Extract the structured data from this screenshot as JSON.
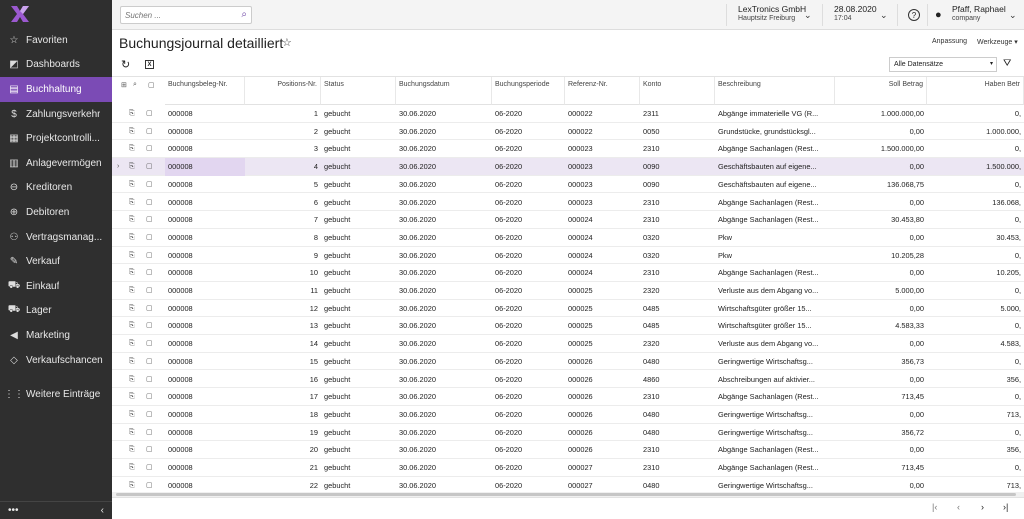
{
  "colors": {
    "accent": "#7b4bb5",
    "sidebar_bg": "#2f2f2f",
    "selected_row": "#ece6f3"
  },
  "sidebar": {
    "items": [
      {
        "label": "Favoriten",
        "icon": "star-icon",
        "glyph": "☆"
      },
      {
        "label": "Dashboards",
        "icon": "dashboard-icon",
        "glyph": "◩"
      },
      {
        "label": "Buchhaltung",
        "icon": "ledger-icon",
        "glyph": "▤",
        "active": true
      },
      {
        "label": "Zahlungsverkehr",
        "icon": "dollar-icon",
        "glyph": "$"
      },
      {
        "label": "Projektcontrolli...",
        "icon": "project-icon",
        "glyph": "▦"
      },
      {
        "label": "Anlagevermögen",
        "icon": "building-icon",
        "glyph": "▥"
      },
      {
        "label": "Kreditoren",
        "icon": "minus-circle-icon",
        "glyph": "⊖"
      },
      {
        "label": "Debitoren",
        "icon": "plus-circle-icon",
        "glyph": "⊕"
      },
      {
        "label": "Vertragsmanag...",
        "icon": "handshake-icon",
        "glyph": "⚇"
      },
      {
        "label": "Verkauf",
        "icon": "edit-icon",
        "glyph": "✎"
      },
      {
        "label": "Einkauf",
        "icon": "cart-icon",
        "glyph": "⛟"
      },
      {
        "label": "Lager",
        "icon": "truck-icon",
        "glyph": "⛟"
      },
      {
        "label": "Marketing",
        "icon": "megaphone-icon",
        "glyph": "◀"
      },
      {
        "label": "Verkaufschancen",
        "icon": "tag-icon",
        "glyph": "◇"
      }
    ],
    "more_label": "Weitere Einträge",
    "footer_dots": "•••",
    "collapse_glyph": "‹"
  },
  "topbar": {
    "search_placeholder": "Suchen ...",
    "company": "LexTronics GmbH",
    "location": "Hauptsitz Freiburg",
    "date": "28.08.2020",
    "time": "17:04",
    "help": "?",
    "user_name": "Pfaff, Raphael",
    "user_sub": "company"
  },
  "page": {
    "title": "Buchungsjournal detailliert",
    "anpassung": "Anpassung",
    "werkzeuge": "Werkzeuge",
    "dataset": "Alle Datensätze"
  },
  "table": {
    "columns": [
      "Buchungsbeleg-Nr.",
      "Positions-Nr.",
      "Status",
      "Buchungsdatum",
      "Buchungsperiode",
      "Referenz-Nr.",
      "Konto",
      "Beschreibung",
      "Soll Betrag",
      "Haben Betr"
    ],
    "rows": [
      [
        "000008",
        "1",
        "gebucht",
        "30.06.2020",
        "06-2020",
        "000022",
        "2311",
        "Abgänge immaterielle VG (R...",
        "1.000.000,00",
        "0,"
      ],
      [
        "000008",
        "2",
        "gebucht",
        "30.06.2020",
        "06-2020",
        "000022",
        "0050",
        "Grundstücke, grundstücksgl...",
        "0,00",
        "1.000.000,"
      ],
      [
        "000008",
        "3",
        "gebucht",
        "30.06.2020",
        "06-2020",
        "000023",
        "2310",
        "Abgänge Sachanlagen (Rest...",
        "1.500.000,00",
        "0,"
      ],
      [
        "000008",
        "4",
        "gebucht",
        "30.06.2020",
        "06-2020",
        "000023",
        "0090",
        "Geschäftsbauten auf eigene...",
        "0,00",
        "1.500.000,"
      ],
      [
        "000008",
        "5",
        "gebucht",
        "30.06.2020",
        "06-2020",
        "000023",
        "0090",
        "Geschäftsbauten auf eigene...",
        "136.068,75",
        "0,"
      ],
      [
        "000008",
        "6",
        "gebucht",
        "30.06.2020",
        "06-2020",
        "000023",
        "2310",
        "Abgänge Sachanlagen (Rest...",
        "0,00",
        "136.068,"
      ],
      [
        "000008",
        "7",
        "gebucht",
        "30.06.2020",
        "06-2020",
        "000024",
        "2310",
        "Abgänge Sachanlagen (Rest...",
        "30.453,80",
        "0,"
      ],
      [
        "000008",
        "8",
        "gebucht",
        "30.06.2020",
        "06-2020",
        "000024",
        "0320",
        "Pkw",
        "0,00",
        "30.453,"
      ],
      [
        "000008",
        "9",
        "gebucht",
        "30.06.2020",
        "06-2020",
        "000024",
        "0320",
        "Pkw",
        "10.205,28",
        "0,"
      ],
      [
        "000008",
        "10",
        "gebucht",
        "30.06.2020",
        "06-2020",
        "000024",
        "2310",
        "Abgänge Sachanlagen (Rest...",
        "0,00",
        "10.205,"
      ],
      [
        "000008",
        "11",
        "gebucht",
        "30.06.2020",
        "06-2020",
        "000025",
        "2320",
        "Verluste aus dem Abgang vo...",
        "5.000,00",
        "0,"
      ],
      [
        "000008",
        "12",
        "gebucht",
        "30.06.2020",
        "06-2020",
        "000025",
        "0485",
        "Wirtschaftsgüter größer 15...",
        "0,00",
        "5.000,"
      ],
      [
        "000008",
        "13",
        "gebucht",
        "30.06.2020",
        "06-2020",
        "000025",
        "0485",
        "Wirtschaftsgüter größer 15...",
        "4.583,33",
        "0,"
      ],
      [
        "000008",
        "14",
        "gebucht",
        "30.06.2020",
        "06-2020",
        "000025",
        "2320",
        "Verluste aus dem Abgang vo...",
        "0,00",
        "4.583,"
      ],
      [
        "000008",
        "15",
        "gebucht",
        "30.06.2020",
        "06-2020",
        "000026",
        "0480",
        "Geringwertige Wirtschaftsg...",
        "356,73",
        "0,"
      ],
      [
        "000008",
        "16",
        "gebucht",
        "30.06.2020",
        "06-2020",
        "000026",
        "4860",
        "Abschreibungen auf aktivier...",
        "0,00",
        "356,"
      ],
      [
        "000008",
        "17",
        "gebucht",
        "30.06.2020",
        "06-2020",
        "000026",
        "2310",
        "Abgänge Sachanlagen (Rest...",
        "713,45",
        "0,"
      ],
      [
        "000008",
        "18",
        "gebucht",
        "30.06.2020",
        "06-2020",
        "000026",
        "0480",
        "Geringwertige Wirtschaftsg...",
        "0,00",
        "713,"
      ],
      [
        "000008",
        "19",
        "gebucht",
        "30.06.2020",
        "06-2020",
        "000026",
        "0480",
        "Geringwertige Wirtschaftsg...",
        "356,72",
        "0,"
      ],
      [
        "000008",
        "20",
        "gebucht",
        "30.06.2020",
        "06-2020",
        "000026",
        "2310",
        "Abgänge Sachanlagen (Rest...",
        "0,00",
        "356,"
      ],
      [
        "000008",
        "21",
        "gebucht",
        "30.06.2020",
        "06-2020",
        "000027",
        "2310",
        "Abgänge Sachanlagen (Rest...",
        "713,45",
        "0,"
      ],
      [
        "000008",
        "22",
        "gebucht",
        "30.06.2020",
        "06-2020",
        "000027",
        "0480",
        "Geringwertige Wirtschaftsg...",
        "0,00",
        "713,"
      ]
    ],
    "selected_row": 3
  },
  "pager": {
    "first": "|‹",
    "prev": "‹",
    "next": "›",
    "last": "›|"
  }
}
